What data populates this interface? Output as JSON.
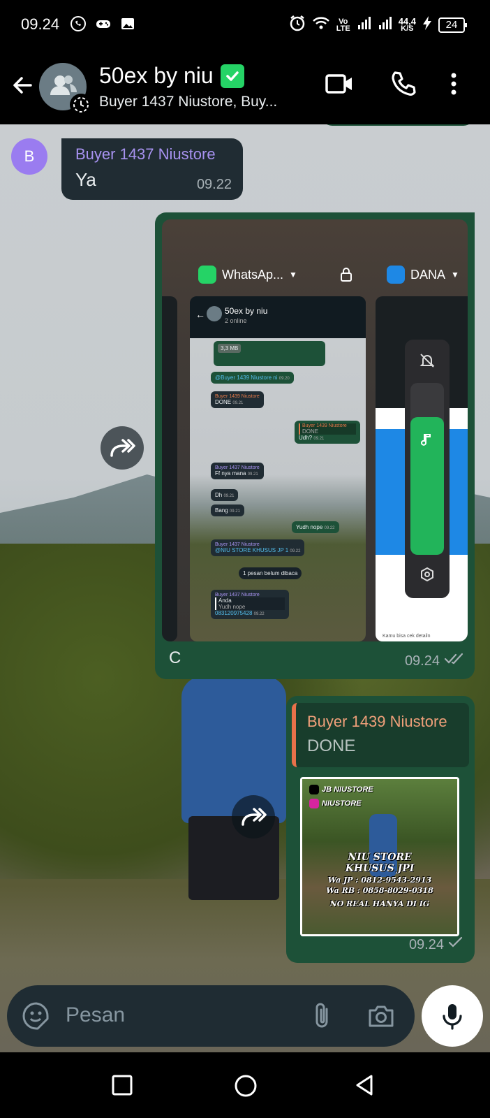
{
  "status_bar": {
    "time": "09.24",
    "network_label": "Vo LTE",
    "speed_value": "44,4",
    "speed_unit": "K/S",
    "battery": "24",
    "icons": [
      "whatsapp-icon",
      "gamepad-icon",
      "image-icon",
      "alarm-icon",
      "wifi-icon",
      "signal-icon",
      "charging-icon"
    ]
  },
  "header": {
    "title": "50ex by niu",
    "subtitle": "Buyer 1437 Niustore, Buy...",
    "icons": [
      "back-arrow-icon",
      "group-avatar-icon",
      "verified-icon",
      "video-call-icon",
      "phone-icon",
      "more-icon"
    ]
  },
  "messages": {
    "incoming": {
      "avatar_letter": "B",
      "sender": "Buyer 1437 Niustore",
      "text": "Ya",
      "time": "09.22"
    },
    "outgoing_image": {
      "caption": "C",
      "time": "09.24",
      "status": "read",
      "screenshot": {
        "app1": "WhatsAp...",
        "app2": "DANA",
        "volume_level": 0.8,
        "mini_chat": {
          "title": "50ex by niu",
          "subtitle": "2 online",
          "file_size": "3,3 MB",
          "msgs": [
            {
              "sender": "",
              "text": "@Buyer 1439 Niustore ni",
              "time": "09.20"
            },
            {
              "sender": "Buyer 1439 Niustore",
              "text": "DONE",
              "time": "09.21"
            },
            {
              "sender": "Buyer 1439 Niustore",
              "quote": "DONE",
              "text": "Udh?",
              "time": "09.21"
            },
            {
              "sender": "Buyer 1437 Niustore",
              "text": "Ff nya mana",
              "time": "09.21"
            },
            {
              "sender": "",
              "text": "Dh",
              "time": "09.21"
            },
            {
              "sender": "",
              "text": "Bang",
              "time": "09.21"
            },
            {
              "sender": "",
              "text": "Yudh nope",
              "time": "09.22"
            },
            {
              "sender": "Buyer 1437 Niustore",
              "text": "@NIU STORE KHUSUS JP 1",
              "time": "09.22"
            },
            {
              "sender": "",
              "text": "1 pesan belum dibaca",
              "time": ""
            },
            {
              "sender": "Buyer 1437 Niustore",
              "quote": "Anda",
              "quote_text": "Yudh nope",
              "text": "083120975428",
              "time": "09.22"
            }
          ],
          "dana_footer": "Kamu bisa cek detailn"
        }
      }
    },
    "outgoing_reply": {
      "quote_sender": "Buyer 1439 Niustore",
      "quote_text": "DONE",
      "time": "09.24",
      "status": "sent",
      "promo": {
        "tag1": "JB NIUSTORE",
        "tag2": "NIUSTORE",
        "line1": "NIU STORE",
        "line2": "KHUSUS JPI",
        "line3": "Wa JP : 0812-9543-2913",
        "line4": "Wa RB : 0858-8029-0318",
        "line5": "NO REAL HANYA DI IG"
      }
    }
  },
  "input": {
    "placeholder": "Pesan",
    "icons": [
      "sticker-icon",
      "attach-icon",
      "camera-icon",
      "mic-icon"
    ]
  },
  "navbar": {
    "icons": [
      "recents-icon",
      "home-icon",
      "back-icon"
    ]
  },
  "colors": {
    "outgoing_bubble": "#1d5138",
    "incoming_bubble": "#202c33",
    "sender_purple": "#a792f0",
    "sender_orange": "#e8714a",
    "accent_green": "#25d366"
  }
}
